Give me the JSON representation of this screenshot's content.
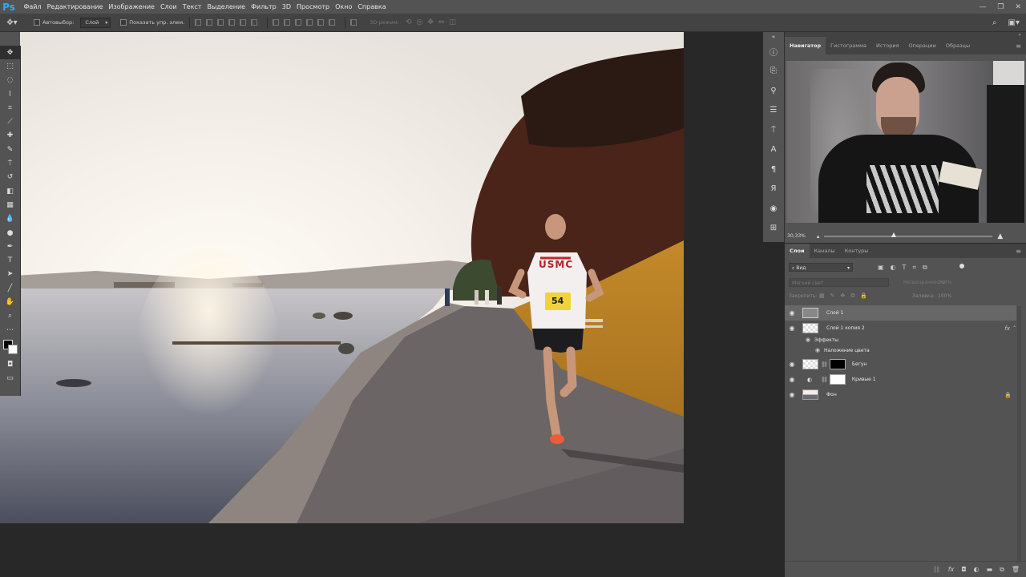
{
  "app": {
    "logo": "Ps"
  },
  "menu": [
    "Файл",
    "Редактирование",
    "Изображение",
    "Слои",
    "Текст",
    "Выделение",
    "Фильтр",
    "3D",
    "Просмотр",
    "Окно",
    "Справка"
  ],
  "options": {
    "autoselect_label": "Автовыбор:",
    "autoselect_value": "Слой",
    "show_transform_label": "Показать упр. элем.",
    "mode_3d_label": "3D-режим:"
  },
  "navigator": {
    "tabs": [
      "Навигатор",
      "Гистограмма",
      "История",
      "Операции",
      "Образцы"
    ],
    "zoom": "30,33%"
  },
  "layers": {
    "tabs": [
      "Слои",
      "Каналы",
      "Контуры"
    ],
    "kind_filter": "Вид",
    "blend_mode": "Мягкий свет",
    "opacity_label": "Непрозрачность:",
    "opacity_value": "100%",
    "lock_label": "Закрепить:",
    "fill_label": "Заливка:",
    "fill_value": "100%",
    "items": [
      {
        "name": "Слой 1"
      },
      {
        "name": "Слой 1 копия 2",
        "fx": "fx"
      },
      {
        "name": "Эффекты"
      },
      {
        "name": "Наложение цвета"
      },
      {
        "name": "Бегун"
      },
      {
        "name": "Кривые 1"
      },
      {
        "name": "Фон"
      }
    ]
  },
  "photo": {
    "bib_number": "54",
    "shirt_text": "USMC"
  },
  "colors": {
    "accent_ps": "#31a8ff",
    "panel_bg": "#535353",
    "workspace_bg": "#282828"
  }
}
